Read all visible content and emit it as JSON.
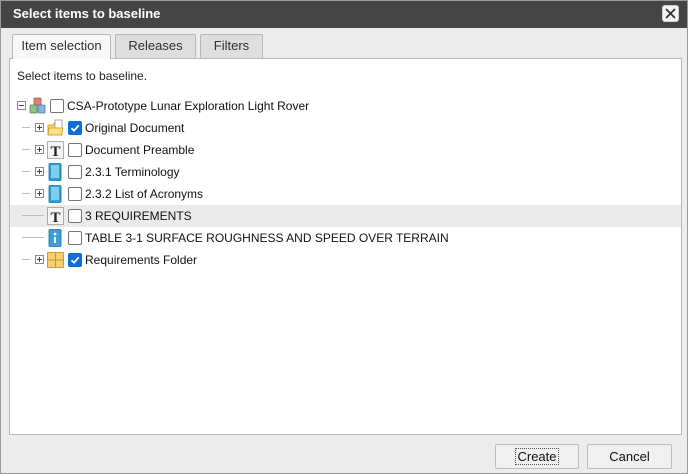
{
  "dialog": {
    "title": "Select items to baseline"
  },
  "tabs": [
    {
      "label": "Item selection",
      "active": true
    },
    {
      "label": "Releases",
      "active": false
    },
    {
      "label": "Filters",
      "active": false
    }
  ],
  "panel": {
    "instruction": "Select items to baseline."
  },
  "tree": [
    {
      "label": "CSA-Prototype Lunar Exploration Light Rover",
      "icon": "project-icon",
      "expander": "minus",
      "checked": false
    },
    {
      "label": "Original Document",
      "icon": "folder-document-icon",
      "expander": "plus",
      "checked": true
    },
    {
      "label": "Document Preamble",
      "icon": "text-item-icon",
      "expander": "plus",
      "checked": false
    },
    {
      "label": "2.3.1 Terminology",
      "icon": "book-icon",
      "expander": "plus",
      "checked": false
    },
    {
      "label": "2.3.2 List of Acronyms",
      "icon": "book-icon",
      "expander": "plus",
      "checked": false
    },
    {
      "label": "3 REQUIREMENTS",
      "icon": "text-item-icon",
      "expander": "none",
      "checked": false
    },
    {
      "label": "TABLE 3-1 SURFACE ROUGHNESS AND SPEED OVER TERRAIN",
      "icon": "info-item-icon",
      "expander": "none",
      "checked": false
    },
    {
      "label": "Requirements Folder",
      "icon": "requirements-folder-icon",
      "expander": "plus",
      "checked": true
    }
  ],
  "buttons": {
    "create": "Create",
    "cancel": "Cancel"
  },
  "colors": {
    "titlebar": "#454545",
    "checkbox_checked": "#0b6fd6",
    "selected_row": "#ebebeb"
  }
}
